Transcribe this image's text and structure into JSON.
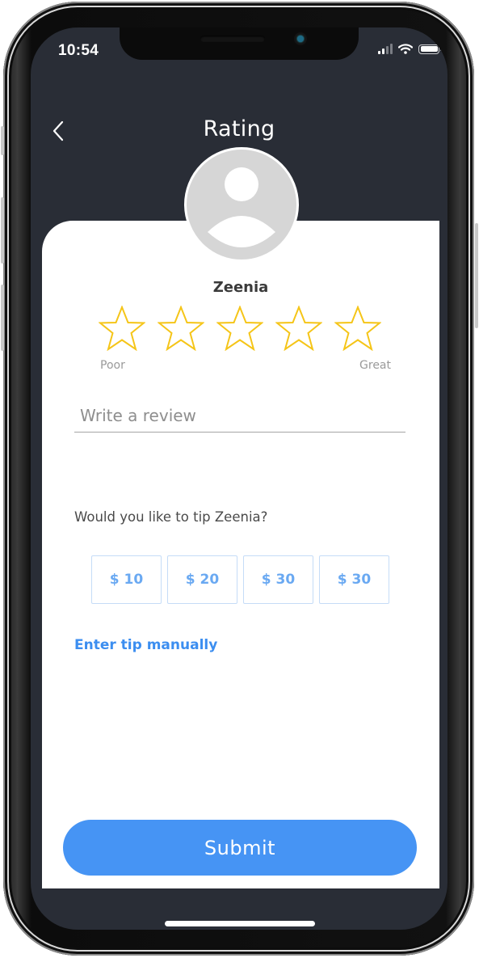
{
  "status_bar": {
    "time": "10:54",
    "icons": [
      "cellular-signal-icon",
      "wifi-icon",
      "battery-icon"
    ]
  },
  "header": {
    "back_icon": "chevron-left-icon",
    "title": "Rating"
  },
  "profile": {
    "avatar_icon": "user-placeholder-icon",
    "name": "Zeenia"
  },
  "rating": {
    "max_stars": 5,
    "selected": 0,
    "star_icon": "star-outline-icon",
    "low_label": "Poor",
    "high_label": "Great",
    "star_color": "#f5c518"
  },
  "review": {
    "value": "",
    "placeholder": "Write a review"
  },
  "tip": {
    "question": "Would you like to tip Zeenia?",
    "options": [
      "$ 10",
      "$ 20",
      "$ 30",
      "$ 30"
    ],
    "manual_label": "Enter tip manually"
  },
  "actions": {
    "submit_label": "Submit"
  },
  "colors": {
    "background_dark": "#292d36",
    "accent_blue": "#4694f4",
    "tip_text_blue": "#6aa9f2"
  }
}
